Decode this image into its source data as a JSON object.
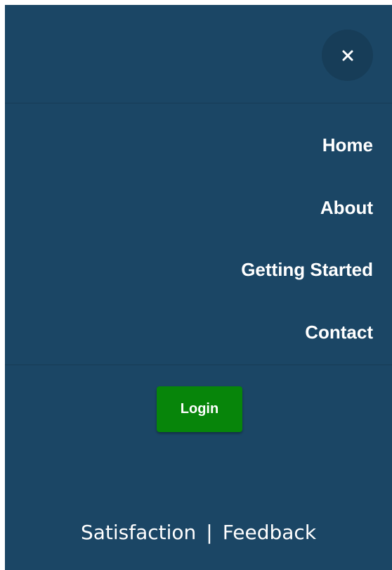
{
  "menu": {
    "close_icon": "close-icon",
    "items": [
      {
        "label": "Home"
      },
      {
        "label": "About"
      },
      {
        "label": "Getting Started"
      },
      {
        "label": "Contact"
      }
    ],
    "login_label": "Login"
  },
  "footer": {
    "satisfaction_label": "Satisfaction",
    "separator": "|",
    "feedback_label": "Feedback"
  },
  "colors": {
    "panel_background": "#1b4665",
    "close_button_background": "#173d58",
    "login_button_background": "#07850a",
    "text": "#ffffff"
  }
}
